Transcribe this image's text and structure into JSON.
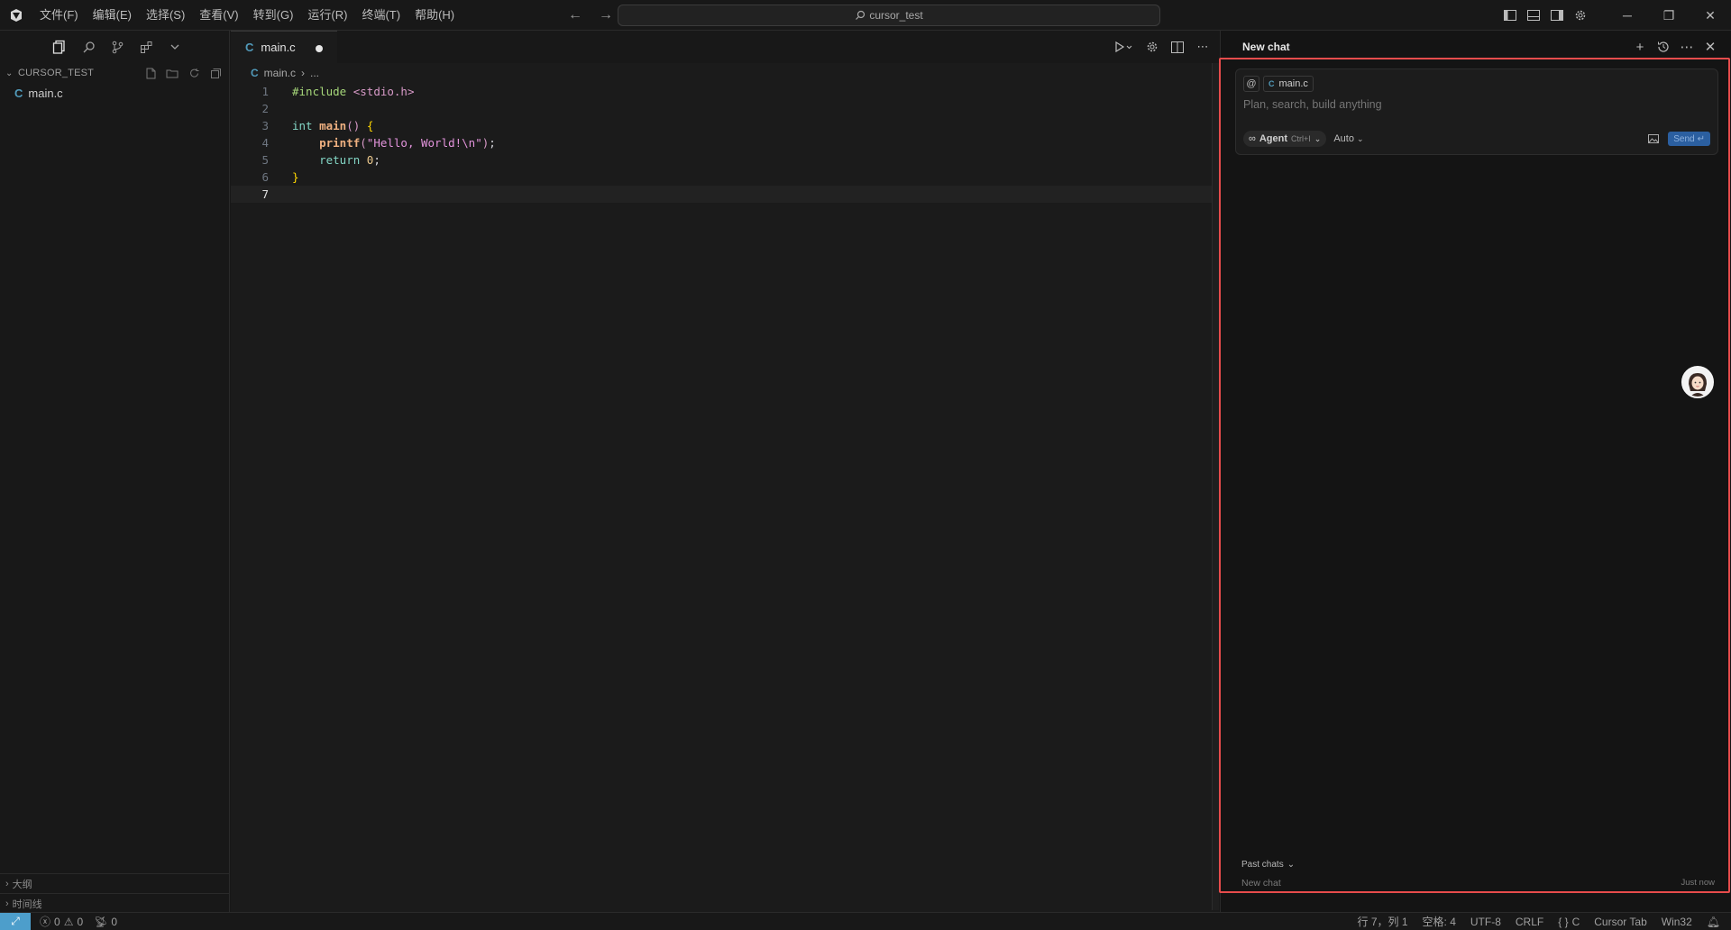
{
  "titlebar": {
    "menu": [
      "文件(F)",
      "编辑(E)",
      "选择(S)",
      "查看(V)",
      "转到(G)",
      "运行(R)",
      "终端(T)",
      "帮助(H)"
    ],
    "search_text": "cursor_test"
  },
  "sidebar": {
    "folder_name": "CURSOR_TEST",
    "files": [
      {
        "name": "main.c",
        "icon": "c-file-icon"
      }
    ],
    "bottom_sections": [
      "大纲",
      "时间线"
    ]
  },
  "editor": {
    "tab": {
      "label": "main.c",
      "modified": true
    },
    "breadcrumb": {
      "file": "main.c",
      "rest": "..."
    },
    "line_numbers": [
      "1",
      "2",
      "3",
      "4",
      "5",
      "6",
      "7"
    ],
    "code_lines": [
      "#include <stdio.h>",
      "",
      "int main() {",
      "    printf(\"Hello, World!\\n\");",
      "    return 0;",
      "}",
      ""
    ],
    "active_line": 7
  },
  "chat": {
    "title": "New chat",
    "context_at": "@",
    "context_file": "main.c",
    "input_placeholder": "Plan, search, build anything",
    "mode_label": "Agent",
    "mode_shortcut": "Ctrl+I",
    "model_label": "Auto",
    "send_label": "Send",
    "past_chats_label": "Past chats",
    "past_chats": [
      {
        "title": "New chat",
        "time": "Just now"
      }
    ]
  },
  "statusbar": {
    "errors": "0",
    "warnings": "0",
    "ports": "0",
    "position": "行 7，列 1",
    "indent": "空格: 4",
    "encoding": "UTF-8",
    "eol": "CRLF",
    "language": "C",
    "cursor_tab": "Cursor Tab",
    "platform": "Win32"
  },
  "colors": {
    "highlight_frame": "#e74c4c",
    "send_button": "#2b5fa0",
    "remote_indicator": "#4d9ecb"
  }
}
